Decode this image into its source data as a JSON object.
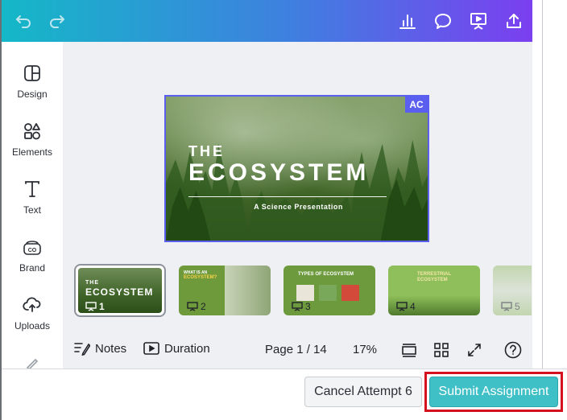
{
  "toolbar": {
    "undo_icon": "undo-icon",
    "redo_icon": "redo-icon",
    "right_icons": [
      "chart-icon",
      "comment-icon",
      "present-icon",
      "share-upload-icon"
    ]
  },
  "sidebar": {
    "items": [
      {
        "label": "Design",
        "icon": "design-icon"
      },
      {
        "label": "Elements",
        "icon": "elements-icon"
      },
      {
        "label": "Text",
        "icon": "text-icon"
      },
      {
        "label": "Brand",
        "icon": "brand-icon"
      },
      {
        "label": "Uploads",
        "icon": "uploads-icon"
      },
      {
        "label": "",
        "icon": "draw-icon"
      }
    ]
  },
  "slide": {
    "line1": "THE",
    "line2": "ECOSYSTEM",
    "subtitle": "A Science Presentation",
    "badge": "AC"
  },
  "thumbnails": [
    {
      "page": "1",
      "title_a": "THE",
      "title_b": "ECOSYSTEM",
      "selected": true
    },
    {
      "page": "2",
      "title_a": "WHAT IS AN",
      "title_b": "ECOSYSTEM?",
      "selected": false
    },
    {
      "page": "3",
      "title_a": "TYPES OF ECOSYSTEM",
      "title_b": "",
      "selected": false
    },
    {
      "page": "4",
      "title_a": "TERRESTRIAL",
      "title_b": "ECOSYSTEM",
      "selected": false
    },
    {
      "page": "5",
      "title_a": "",
      "title_b": "",
      "selected": false
    }
  ],
  "footer": {
    "notes_label": "Notes",
    "duration_label": "Duration",
    "page_indicator": "Page 1 / 14",
    "zoom": "17%"
  },
  "actions": {
    "cancel_label": "Cancel Attempt 6",
    "submit_label": "Submit Assignment"
  },
  "colors": {
    "accent": "#5b5ff0",
    "submit": "#3fbfc6",
    "highlight": "#d4111e"
  }
}
